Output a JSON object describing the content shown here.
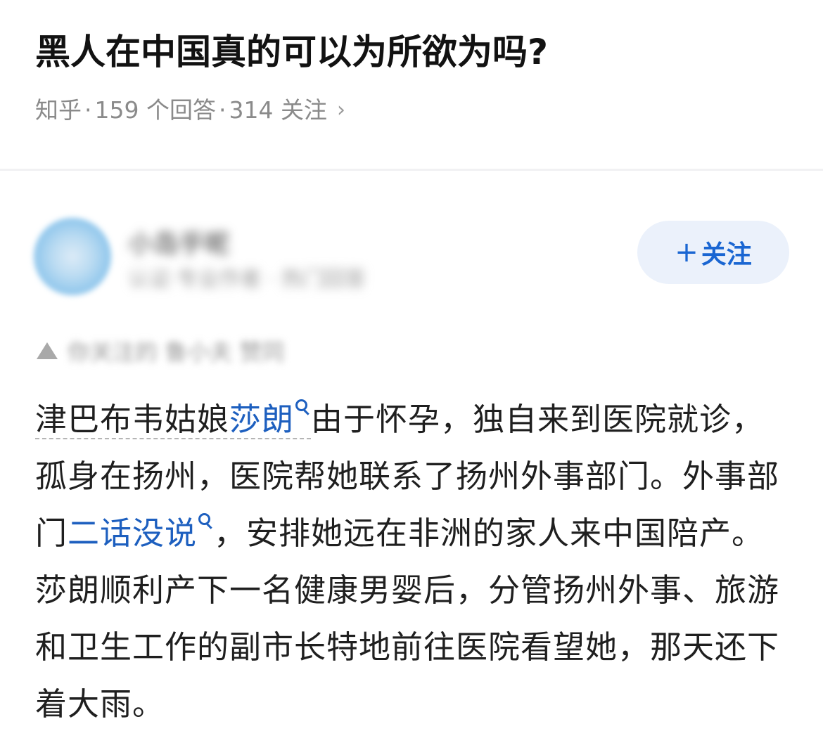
{
  "question": {
    "title": "黑人在中国真的可以为所欲为吗?",
    "source": "知乎",
    "answers": "159 个回答",
    "followers": "314 关注",
    "chevron": "›"
  },
  "author": {
    "name": "小岛乎呢",
    "bio": "认证·专业作者 · 热门回答",
    "follow_label": "关注",
    "follow_plus": "+"
  },
  "upvote": {
    "text": "你关注的 鲁小夫 赞同",
    "icon": "triangle-up-icon"
  },
  "answer": {
    "seg1": "津巴布韦姑娘",
    "kw1": "莎朗",
    "seg2": "由于怀孕，独自来到医院就诊，孤身在扬州，医院帮她联系了扬州外事部门。外事部门",
    "kw2": "二话没说",
    "seg3": "，安排她远在非洲的家人来中国陪产。莎朗顺利产下一名健康男婴后，分管扬州外事、旅游和卫生工作的副市长特地前往医院看望她，那天还下着大雨。"
  },
  "colors": {
    "link": "#1d5fbf",
    "follow_bg": "#ebf1fb",
    "meta": "#8a8a8a"
  }
}
